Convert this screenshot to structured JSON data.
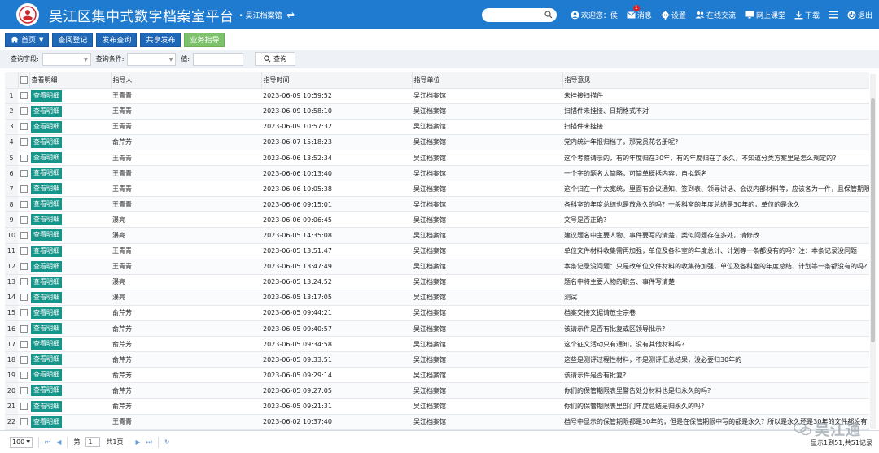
{
  "header": {
    "app_title": "吴江区集中式数字档案室平台",
    "org_name": "• 吴江档案馆",
    "search_placeholder": "",
    "welcome": "欢迎您：侯",
    "messages": "消息",
    "messages_badge": "1",
    "settings": "设置",
    "online_chat": "在线交流",
    "online_class": "网上课堂",
    "download": "下载",
    "logout": "退出"
  },
  "nav": {
    "home": "首页",
    "query_register": "查阅登记",
    "publish_query": "发布查询",
    "share_publish": "共享发布",
    "business_guide": "业务指导"
  },
  "filter": {
    "field_label": "查询字段:",
    "condition_label": "查询条件:",
    "value_label": "值:",
    "query_button": "查询"
  },
  "table": {
    "columns": [
      "查看明细",
      "指导人",
      "指导时间",
      "指导单位",
      "指导意见"
    ],
    "view_label": "查看明细",
    "rows": [
      {
        "no": "1",
        "person": "王青青",
        "time": "2023-06-09 10:59:52",
        "unit": "吴江档案馆",
        "opinion": "未挂接扫描件"
      },
      {
        "no": "2",
        "person": "王青青",
        "time": "2023-06-09 10:58:10",
        "unit": "吴江档案馆",
        "opinion": "扫描件未挂接、日期格式不对"
      },
      {
        "no": "3",
        "person": "王青青",
        "time": "2023-06-09 10:57:32",
        "unit": "吴江档案馆",
        "opinion": "扫描件未挂接"
      },
      {
        "no": "4",
        "person": "俞芹芳",
        "time": "2023-06-07 15:18:23",
        "unit": "吴江档案馆",
        "opinion": "党内统计年报归档了，那党员花名册呢?"
      },
      {
        "no": "5",
        "person": "王青青",
        "time": "2023-06-06 13:52:34",
        "unit": "吴江档案馆",
        "opinion": "这个考察请示的，有的年度归在30年，有的年度归在了永久，不知道分类方案里是怎么规定的?"
      },
      {
        "no": "6",
        "person": "王青青",
        "time": "2023-06-06 10:13:40",
        "unit": "吴江档案馆",
        "opinion": "一个字的题名太简略，可简单概括内容，自拟题名"
      },
      {
        "no": "7",
        "person": "王青青",
        "time": "2023-06-06 10:05:38",
        "unit": "吴江档案馆",
        "opinion": "这个归在一件太宽统，里面有会议通知、签到表、领导讲话、会议内部材料等，应该各为一件，且保管期限..."
      },
      {
        "no": "8",
        "person": "王青青",
        "time": "2023-06-06 09:15:01",
        "unit": "吴江档案馆",
        "opinion": "各科室的年度总结也是放永久的吗？一般科室的年度总结是30年的，单位的是永久"
      },
      {
        "no": "9",
        "person": "瀑亮",
        "time": "2023-06-06 09:06:45",
        "unit": "吴江档案馆",
        "opinion": "文号是否正确?"
      },
      {
        "no": "10",
        "person": "瀑亮",
        "time": "2023-06-05 14:35:08",
        "unit": "吴江档案馆",
        "opinion": "建议题名中主要人物、事件要写的清楚，类似问题存在多处，请修改"
      },
      {
        "no": "11",
        "person": "王青青",
        "time": "2023-06-05 13:51:47",
        "unit": "吴江档案馆",
        "opinion": "单位文件材料收集需再加强，单位及各科室的年度总计、计划等一条都没有的吗？注：本条记录没问题"
      },
      {
        "no": "12",
        "person": "王青青",
        "time": "2023-06-05 13:47:49",
        "unit": "吴江档案馆",
        "opinion": "本条记录没问题：只是改单位文件材料的收集待加强，单位及各科室的年度总结、计划等一条都没有的吗?"
      },
      {
        "no": "13",
        "person": "瀑亮",
        "time": "2023-06-05 13:24:52",
        "unit": "吴江档案馆",
        "opinion": "题名中将主要人物的职务、事件写清楚"
      },
      {
        "no": "14",
        "person": "瀑亮",
        "time": "2023-06-05 13:17:05",
        "unit": "吴江档案馆",
        "opinion": "测试"
      },
      {
        "no": "15",
        "person": "俞芹芳",
        "time": "2023-06-05 09:44:21",
        "unit": "吴江档案馆",
        "opinion": "档案交接文据请放全宗卷"
      },
      {
        "no": "16",
        "person": "俞芹芳",
        "time": "2023-06-05 09:40:57",
        "unit": "吴江档案馆",
        "opinion": "该请示件是否有批复或区领导批示?"
      },
      {
        "no": "17",
        "person": "俞芹芳",
        "time": "2023-06-05 09:34:58",
        "unit": "吴江档案馆",
        "opinion": "这个征文活动只有通知，没有其他材料吗?"
      },
      {
        "no": "18",
        "person": "俞芹芳",
        "time": "2023-06-05 09:33:51",
        "unit": "吴江档案馆",
        "opinion": "这些是测评过程性材料，不是测评汇总结果，没必要归30年的"
      },
      {
        "no": "19",
        "person": "俞芹芳",
        "time": "2023-06-05 09:29:14",
        "unit": "吴江档案馆",
        "opinion": "该请示件是否有批复?"
      },
      {
        "no": "20",
        "person": "俞芹芳",
        "time": "2023-06-05 09:27:05",
        "unit": "吴江档案馆",
        "opinion": "你们的保管期限表里警告处分材料也是归永久的吗?"
      },
      {
        "no": "21",
        "person": "俞芹芳",
        "time": "2023-06-05 09:21:31",
        "unit": "吴江档案馆",
        "opinion": "你们的保管期限表里部门年度总结是归永久的吗?"
      },
      {
        "no": "22",
        "person": "王青青",
        "time": "2023-06-02 10:37:40",
        "unit": "吴江档案馆",
        "opinion": "档号中显示的保管期限都是30年的，但是在保管期限中写的都是永久？所以是永久还是30年的文件都没有..."
      }
    ]
  },
  "pager": {
    "page_size": "100",
    "page_prefix": "第",
    "page_value": "1",
    "page_suffix": "共1页",
    "info": "显示1到51,共51记录"
  },
  "watermark": {
    "text": "吴江通"
  },
  "colors": {
    "header_bg": "#1f7bd0",
    "nav_button": "#1f68b8",
    "nav_active": "#7cc26a",
    "view_button": "#16958a"
  }
}
